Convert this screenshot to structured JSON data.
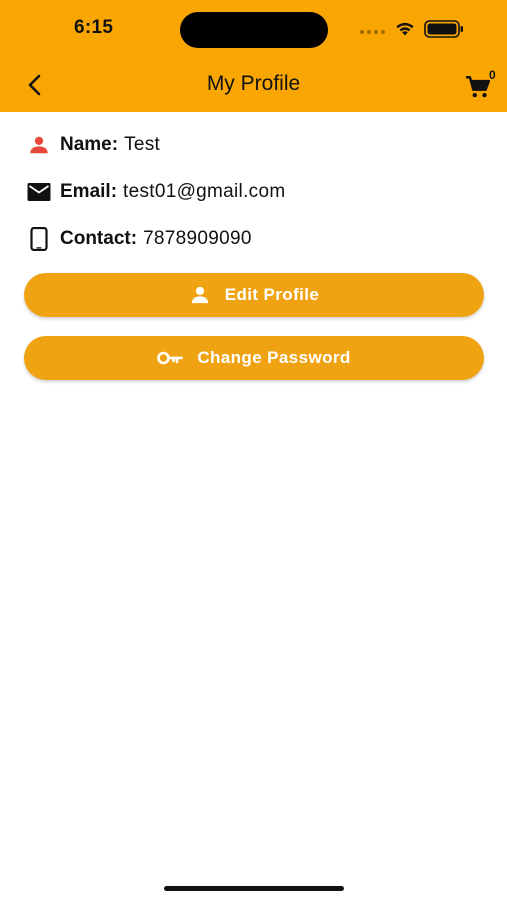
{
  "status_bar": {
    "time": "6:15"
  },
  "header": {
    "title": "My Profile",
    "cart_count": "0"
  },
  "profile": {
    "name_label": "Name:",
    "name_value": "Test",
    "email_label": "Email:",
    "email_value": "test01@gmail.com",
    "contact_label": "Contact:",
    "contact_value": "7878909090"
  },
  "actions": {
    "edit_profile_label": "Edit Profile",
    "change_password_label": "Change Password"
  },
  "colors": {
    "header_bg": "#F9A603",
    "button_bg": "#F0A312",
    "name_icon": "#E5473B",
    "text": "#111111"
  },
  "icons": {
    "back": "chevron-left-icon",
    "cart": "cart-icon",
    "name": "person-icon",
    "email": "envelope-icon",
    "contact": "phone-icon",
    "edit_profile": "person-icon",
    "change_password": "key-icon"
  }
}
